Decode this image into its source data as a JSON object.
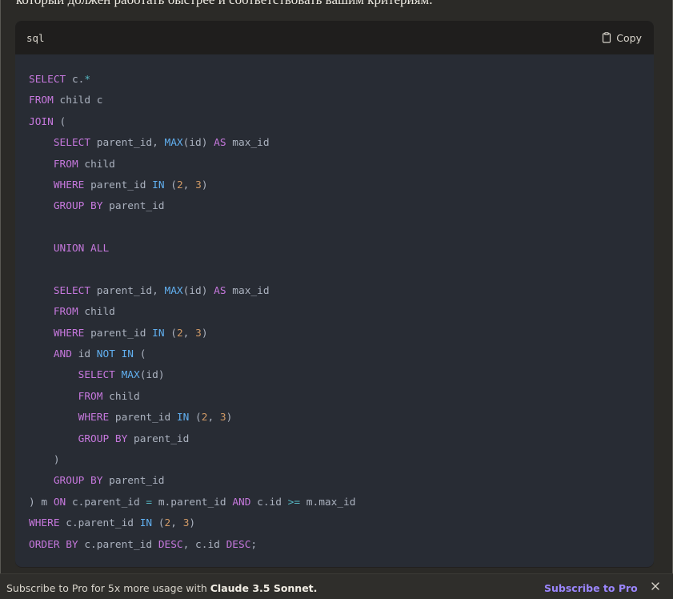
{
  "message": {
    "intro_text": "который должен работать быстрее и соответствовать вашим критериям."
  },
  "code_block": {
    "language": "sql",
    "copy_label": "Copy",
    "copy_icon": "clipboard-icon",
    "lines": [
      [
        {
          "t": "kw",
          "v": "SELECT"
        },
        {
          "t": "txt",
          "v": " c."
        },
        {
          "t": "op",
          "v": "*"
        }
      ],
      [
        {
          "t": "kw",
          "v": "FROM"
        },
        {
          "t": "txt",
          "v": " child c"
        }
      ],
      [
        {
          "t": "kw",
          "v": "JOIN"
        },
        {
          "t": "txt",
          "v": " ("
        }
      ],
      [
        {
          "t": "txt",
          "v": "    "
        },
        {
          "t": "kw",
          "v": "SELECT"
        },
        {
          "t": "txt",
          "v": " parent_id, "
        },
        {
          "t": "fn",
          "v": "MAX"
        },
        {
          "t": "txt",
          "v": "(id) "
        },
        {
          "t": "kw",
          "v": "AS"
        },
        {
          "t": "txt",
          "v": " max_id"
        }
      ],
      [
        {
          "t": "txt",
          "v": "    "
        },
        {
          "t": "kw",
          "v": "FROM"
        },
        {
          "t": "txt",
          "v": " child"
        }
      ],
      [
        {
          "t": "txt",
          "v": "    "
        },
        {
          "t": "kw",
          "v": "WHERE"
        },
        {
          "t": "txt",
          "v": " parent_id "
        },
        {
          "t": "fn",
          "v": "IN"
        },
        {
          "t": "txt",
          "v": " ("
        },
        {
          "t": "num",
          "v": "2"
        },
        {
          "t": "txt",
          "v": ", "
        },
        {
          "t": "num",
          "v": "3"
        },
        {
          "t": "txt",
          "v": ")"
        }
      ],
      [
        {
          "t": "txt",
          "v": "    "
        },
        {
          "t": "kw",
          "v": "GROUP BY"
        },
        {
          "t": "txt",
          "v": " parent_id"
        }
      ],
      [],
      [
        {
          "t": "txt",
          "v": "    "
        },
        {
          "t": "kw",
          "v": "UNION ALL"
        }
      ],
      [],
      [
        {
          "t": "txt",
          "v": "    "
        },
        {
          "t": "kw",
          "v": "SELECT"
        },
        {
          "t": "txt",
          "v": " parent_id, "
        },
        {
          "t": "fn",
          "v": "MAX"
        },
        {
          "t": "txt",
          "v": "(id) "
        },
        {
          "t": "kw",
          "v": "AS"
        },
        {
          "t": "txt",
          "v": " max_id"
        }
      ],
      [
        {
          "t": "txt",
          "v": "    "
        },
        {
          "t": "kw",
          "v": "FROM"
        },
        {
          "t": "txt",
          "v": " child"
        }
      ],
      [
        {
          "t": "txt",
          "v": "    "
        },
        {
          "t": "kw",
          "v": "WHERE"
        },
        {
          "t": "txt",
          "v": " parent_id "
        },
        {
          "t": "fn",
          "v": "IN"
        },
        {
          "t": "txt",
          "v": " ("
        },
        {
          "t": "num",
          "v": "2"
        },
        {
          "t": "txt",
          "v": ", "
        },
        {
          "t": "num",
          "v": "3"
        },
        {
          "t": "txt",
          "v": ")"
        }
      ],
      [
        {
          "t": "txt",
          "v": "    "
        },
        {
          "t": "kw",
          "v": "AND"
        },
        {
          "t": "txt",
          "v": " id "
        },
        {
          "t": "fn",
          "v": "NOT IN"
        },
        {
          "t": "txt",
          "v": " ("
        }
      ],
      [
        {
          "t": "txt",
          "v": "        "
        },
        {
          "t": "kw",
          "v": "SELECT"
        },
        {
          "t": "txt",
          "v": " "
        },
        {
          "t": "fn",
          "v": "MAX"
        },
        {
          "t": "txt",
          "v": "(id)"
        }
      ],
      [
        {
          "t": "txt",
          "v": "        "
        },
        {
          "t": "kw",
          "v": "FROM"
        },
        {
          "t": "txt",
          "v": " child"
        }
      ],
      [
        {
          "t": "txt",
          "v": "        "
        },
        {
          "t": "kw",
          "v": "WHERE"
        },
        {
          "t": "txt",
          "v": " parent_id "
        },
        {
          "t": "fn",
          "v": "IN"
        },
        {
          "t": "txt",
          "v": " ("
        },
        {
          "t": "num",
          "v": "2"
        },
        {
          "t": "txt",
          "v": ", "
        },
        {
          "t": "num",
          "v": "3"
        },
        {
          "t": "txt",
          "v": ")"
        }
      ],
      [
        {
          "t": "txt",
          "v": "        "
        },
        {
          "t": "kw",
          "v": "GROUP BY"
        },
        {
          "t": "txt",
          "v": " parent_id"
        }
      ],
      [
        {
          "t": "txt",
          "v": "    )"
        }
      ],
      [
        {
          "t": "txt",
          "v": "    "
        },
        {
          "t": "kw",
          "v": "GROUP BY"
        },
        {
          "t": "txt",
          "v": " parent_id"
        }
      ],
      [
        {
          "t": "txt",
          "v": ") m "
        },
        {
          "t": "kw",
          "v": "ON"
        },
        {
          "t": "txt",
          "v": " c.parent_id "
        },
        {
          "t": "op",
          "v": "="
        },
        {
          "t": "txt",
          "v": " m.parent_id "
        },
        {
          "t": "kw",
          "v": "AND"
        },
        {
          "t": "txt",
          "v": " c.id "
        },
        {
          "t": "op",
          "v": ">="
        },
        {
          "t": "txt",
          "v": " m.max_id"
        }
      ],
      [
        {
          "t": "kw",
          "v": "WHERE"
        },
        {
          "t": "txt",
          "v": " c.parent_id "
        },
        {
          "t": "fn",
          "v": "IN"
        },
        {
          "t": "txt",
          "v": " ("
        },
        {
          "t": "num",
          "v": "2"
        },
        {
          "t": "txt",
          "v": ", "
        },
        {
          "t": "num",
          "v": "3"
        },
        {
          "t": "txt",
          "v": ")"
        }
      ],
      [
        {
          "t": "kw",
          "v": "ORDER BY"
        },
        {
          "t": "txt",
          "v": " c.parent_id "
        },
        {
          "t": "kw",
          "v": "DESC"
        },
        {
          "t": "txt",
          "v": ", c.id "
        },
        {
          "t": "kw",
          "v": "DESC"
        },
        {
          "t": "txt",
          "v": ";"
        }
      ]
    ]
  },
  "banner": {
    "prefix": "Subscribe to Pro for 5x more usage with ",
    "model_name": "Claude 3.5 Sonnet.",
    "subscribe_label": "Subscribe to Pro",
    "close_icon": "close-icon"
  },
  "colors": {
    "page_background": "#2b2a27",
    "code_background": "#282c34",
    "code_header": "#1f1e1d",
    "keyword": "#c678dd",
    "function": "#61afef",
    "number": "#d19a66",
    "operator": "#56b6c2",
    "plain_text": "#abb2bf",
    "link": "#9b86ff"
  }
}
